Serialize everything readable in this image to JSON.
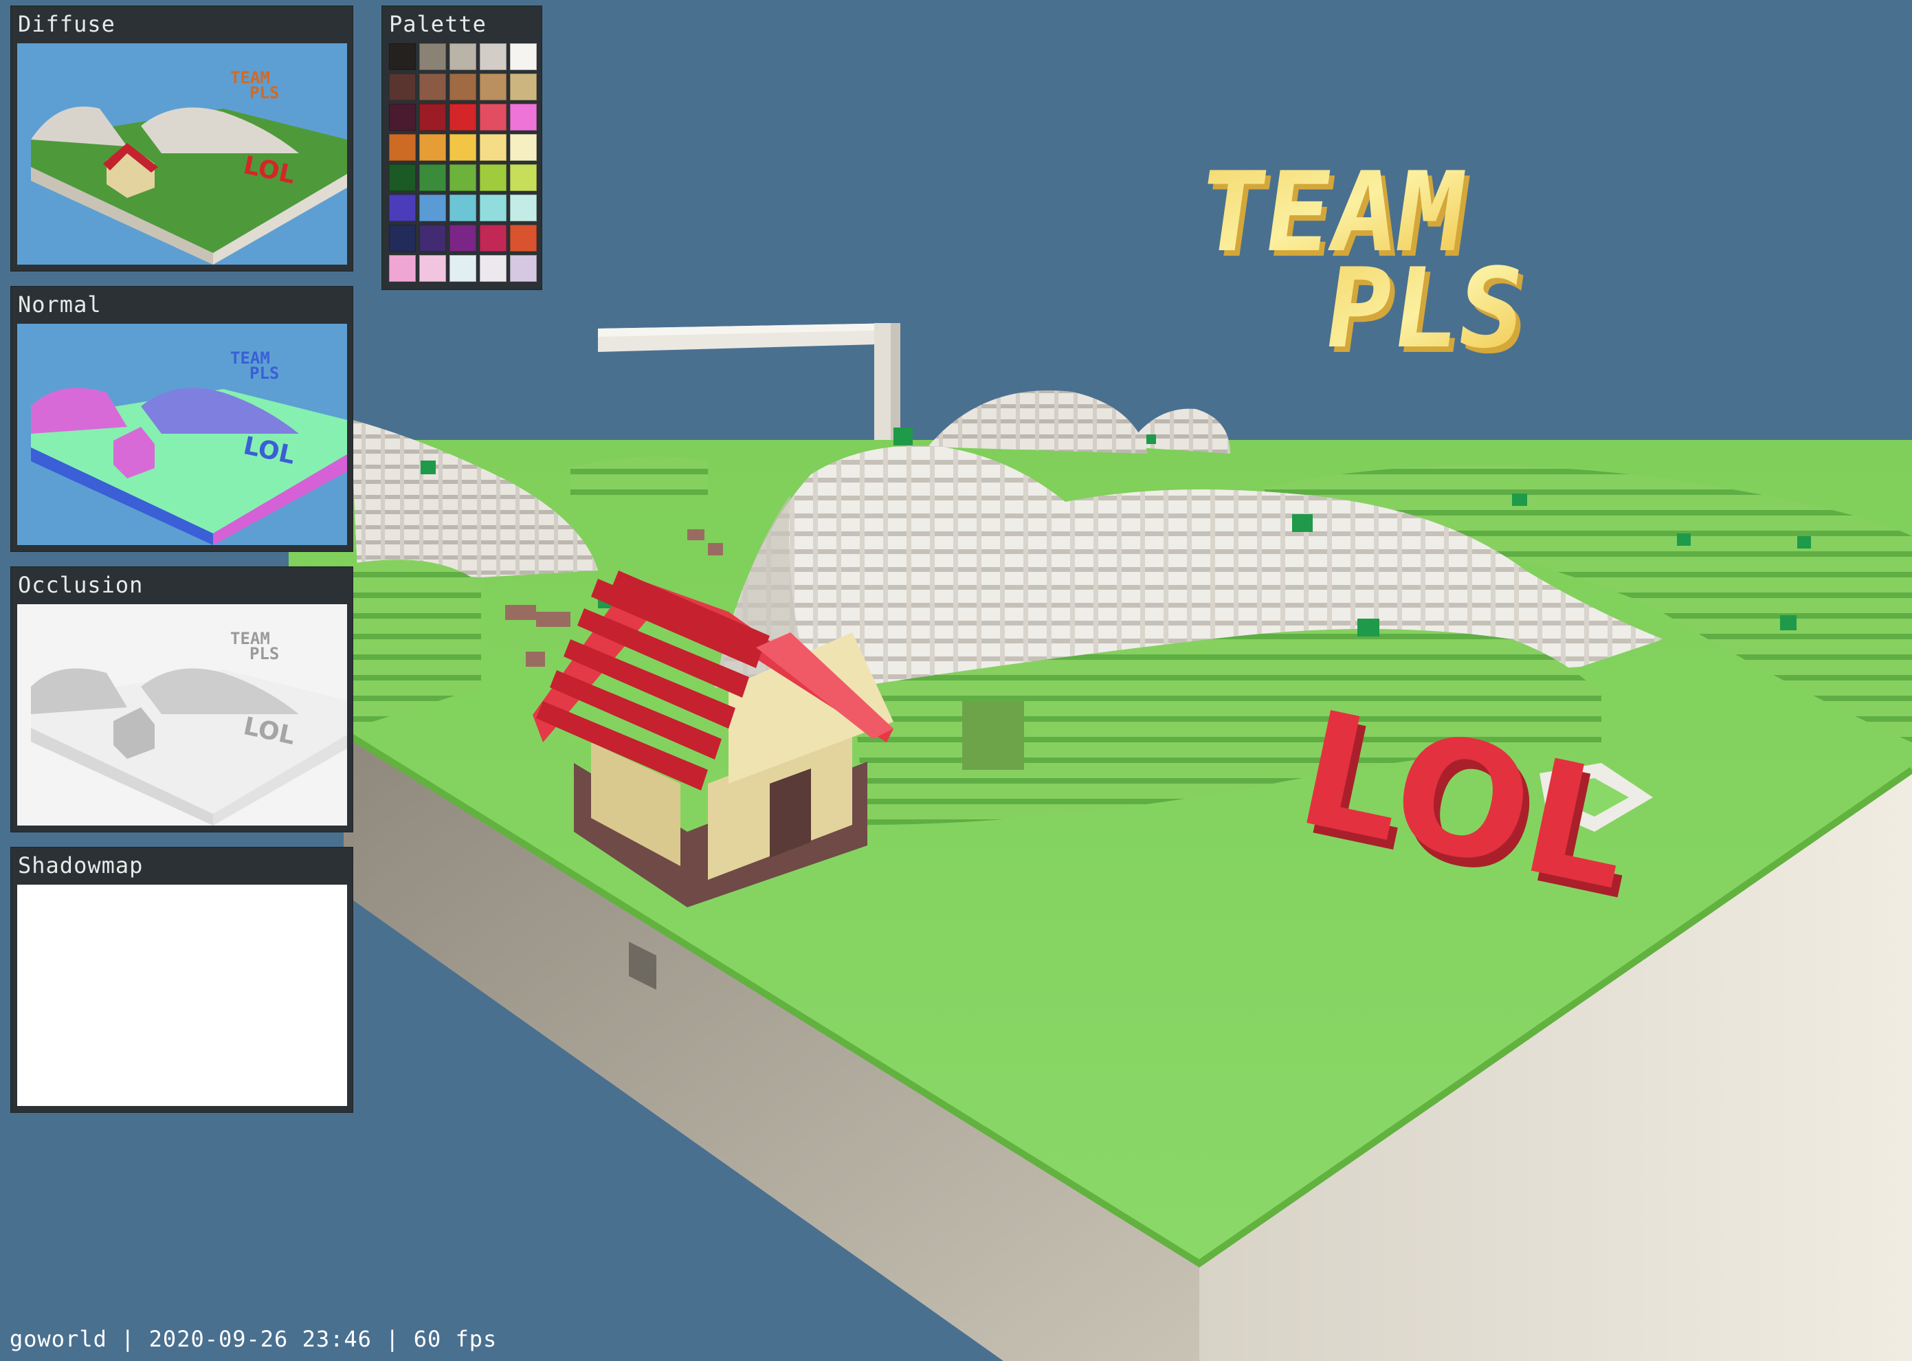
{
  "panels": {
    "diffuse": {
      "title": "Diffuse"
    },
    "normal": {
      "title": "Normal"
    },
    "occlusion": {
      "title": "Occlusion"
    },
    "shadowmap": {
      "title": "Shadowmap"
    },
    "palette": {
      "title": "Palette"
    }
  },
  "palette_colors": [
    "#25211f",
    "#8b8276",
    "#b9b3a8",
    "#d2cec7",
    "#f6f4f1",
    "#5a3530",
    "#8a5a45",
    "#a06a42",
    "#bb8f5e",
    "#cdb57f",
    "#4a1a2e",
    "#9b1c24",
    "#d42628",
    "#e24d62",
    "#ee74d8",
    "#cd6a24",
    "#e69d36",
    "#f2c544",
    "#f5dc86",
    "#f6efc2",
    "#1b5a24",
    "#3a8c3a",
    "#6db23b",
    "#9fcc3d",
    "#c6de5a",
    "#4a3db9",
    "#5a9bd6",
    "#6cc5d5",
    "#91dcdd",
    "#c3ece6",
    "#232b5a",
    "#422b72",
    "#7b2586",
    "#c22855",
    "#d9532f",
    "#f0a6d5",
    "#f1c4e0",
    "#e1eef2",
    "#ece8ee",
    "#d6c8e2"
  ],
  "scene_text": {
    "team": "TEAM",
    "pls": "PLS",
    "lol": "LOL"
  },
  "status": {
    "text": "goworld | 2020-09-26 23:46 | 60 fps"
  }
}
